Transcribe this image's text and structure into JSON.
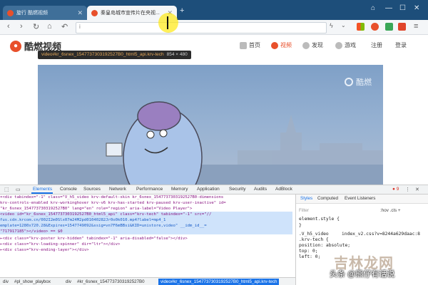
{
  "browser": {
    "tabs": [
      {
        "title": "旋行 酷燃视频",
        "active": false
      },
      {
        "title": "秦皇岛城市宣传片在央视...",
        "active": true
      }
    ],
    "new_tab": "+",
    "window_controls": [
      "⌂",
      "—",
      "☐",
      "✕"
    ],
    "nav": {
      "back": "‹",
      "forward": "›",
      "reload": "↻",
      "home": "⌂",
      "undo": "↶"
    },
    "url": {
      "info_icon": "i",
      "value": ""
    }
  },
  "site": {
    "logo_text": "酷燃视频",
    "menu": [
      {
        "label": "首页",
        "active": false
      },
      {
        "label": "视频",
        "active": true
      },
      {
        "label": "发现",
        "active": false
      },
      {
        "label": "游戏",
        "active": false
      },
      {
        "label": "注册",
        "active": false
      },
      {
        "label": "登录",
        "active": false
      }
    ],
    "player_watermark": "酷燃"
  },
  "inspector_tooltip": {
    "selector": "video#kr_6snex_1547737303192527B0_html5_api.krv-tech",
    "size": "854 × 480"
  },
  "devtools": {
    "tabs": [
      "Elements",
      "Console",
      "Sources",
      "Network",
      "Performance",
      "Memory",
      "Application",
      "Security",
      "Audits",
      "AdBlock"
    ],
    "error_count": "9",
    "dom_lines": [
      "▾<div tabindex=\"-1\" class=\"V_h5_video krv-default-skin kr_6snex_1547737303192527B0-dimensions",
      "  krv-controls-enabled krv-workinghover krv-v6 krv-has-started krv-paused krv-user-inactive\" id=",
      "  \"kr_6snex_1547737303192527B0\" lang=\"en\" role=\"region\" aria-label=\"Video Player\">",
      "    <video id=\"kr_6snex_1547737303192527B0_html5_api\" class=\"krv-tech\" tabindex=\"-1\" src=\"//",
      "    fus.cdn.krcom.cn/002I2m0Slx07m24M2pd01040282Jr0o0k010.mp4?label=mp4_1",
      "    emplate=1280x720.28&Expires=1547749092&ssig=vn7F6mBBsi&KID=unistore,video\" __idm_id__=",
      "    \"717917185\"></video> == $0",
      "  ▸<div class=\"krv-poster krv-hidden\" tabindex=\"-1\" aria-disabled=\"false\"></div>",
      "  ▸<div class=\"krv-loading-spinner\" dir=\"ltr\"></div>",
      "  ▸<div class=\"krv-ending-layer\"></div>"
    ],
    "breadcrumbs": [
      "div",
      "#pl_show_playbox",
      "div",
      "#kr_6snex_1547737303192527B0",
      "video#kr_6snex_1547737303192527B0_html5_api.krv-tech"
    ],
    "styles_tabs": [
      "Styles",
      "Computed",
      "Event Listeners"
    ],
    "filter_placeholder": "Filter",
    "filter_options": ":hov .cls +",
    "rules": [
      "element.style {",
      "}",
      ".V_h5_video",
      ".krv-tech {",
      "  position: absolute;",
      "  top: 0;",
      "  left: 0;"
    ],
    "rule_source": "index_v2.css?v=8244a629daac:8"
  },
  "watermark": {
    "site": "吉林龙网",
    "account": "头条 @熊仔有话说"
  }
}
